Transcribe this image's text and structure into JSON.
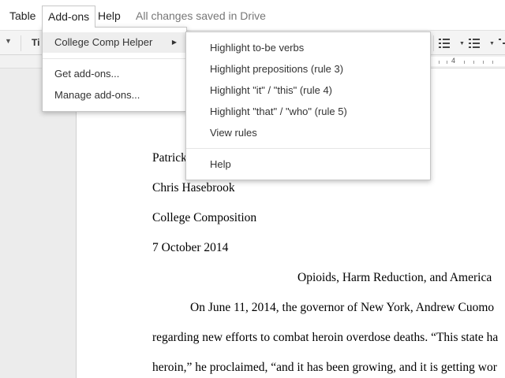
{
  "menubar": {
    "items": [
      {
        "label": "Table"
      },
      {
        "label": "Add-ons"
      },
      {
        "label": "Help"
      }
    ],
    "save_status": "All changes saved in Drive"
  },
  "toolbar": {
    "style_label": "Ti",
    "ruler_number": "4",
    "icons": [
      "numbered-list-icon",
      "bulleted-list-icon",
      "indent-icon"
    ]
  },
  "addons_menu": {
    "items": [
      {
        "label": "College Comp Helper",
        "has_submenu": true
      },
      {
        "label": "Get add-ons..."
      },
      {
        "label": "Manage add-ons..."
      }
    ]
  },
  "submenu": {
    "items": [
      {
        "label": "Highlight to-be verbs"
      },
      {
        "label": "Highlight prepositions (rule 3)"
      },
      {
        "label": "Highlight \"it\" / \"this\" (rule 4)"
      },
      {
        "label": "Highlight \"that\" / \"who\" (rule 5)"
      },
      {
        "label": "View rules"
      },
      {
        "label": "Help"
      }
    ]
  },
  "document": {
    "lines": [
      "Patrick",
      "Chris Hasebrook",
      "College Composition",
      "7 October 2014",
      "Opioids, Harm Reduction, and America",
      "On June 11, 2014, the governor of New York, Andrew Cuomo",
      "regarding new efforts to combat heroin overdose deaths. “This state ha",
      "heroin,” he proclaimed, “and it has been growing, and it is getting wor"
    ]
  }
}
